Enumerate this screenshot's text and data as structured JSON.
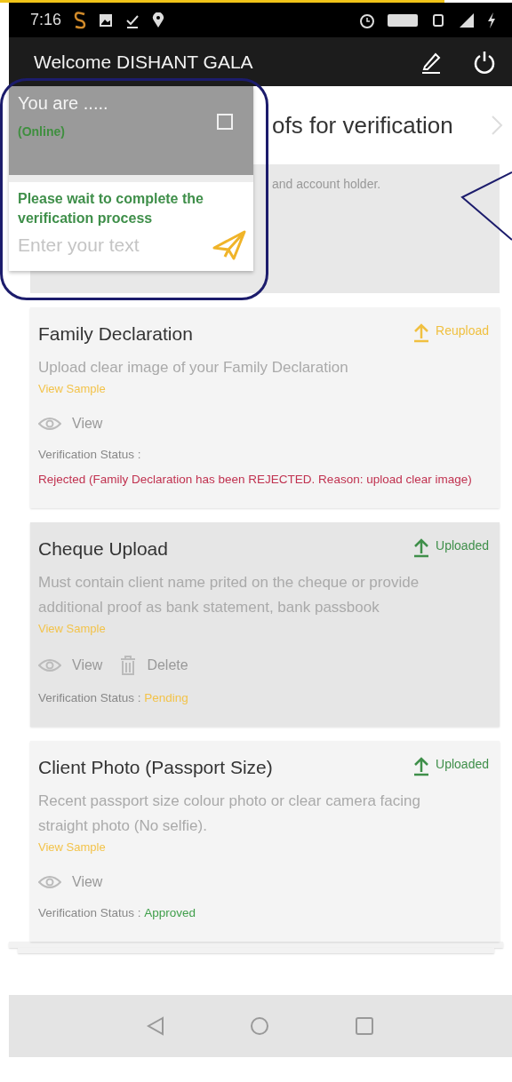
{
  "status_bar": {
    "time": "7:16"
  },
  "app_bar": {
    "title": "Welcome DISHANT GALA"
  },
  "page": {
    "title": "ofs for verification",
    "top_card_text": "and account holder."
  },
  "documents": [
    {
      "title": "Family Declaration",
      "upload": {
        "kind": "reupload",
        "label": "Reupload"
      },
      "description": "Upload clear image of your Family Declaration",
      "sample_link": "View Sample",
      "actions": [
        {
          "kind": "view",
          "label": "View"
        }
      ],
      "status_label": "Verification Status :",
      "status_value": "Rejected (Family Declaration has been REJECTED. Reason: upload clear image)",
      "color": "#c0314f",
      "selected": false
    },
    {
      "title": "Cheque Upload",
      "upload": {
        "kind": "uploaded",
        "label": "Uploaded"
      },
      "description": "Must contain client name prited on the cheque or provide additional proof as bank statement, bank passbook",
      "sample_link": "View Sample",
      "actions": [
        {
          "kind": "view",
          "label": "View"
        },
        {
          "kind": "delete",
          "label": "Delete"
        }
      ],
      "status_label": "Verification Status :",
      "status_value": "Pending",
      "color": "#f3c34a",
      "selected": true
    },
    {
      "title": "Client Photo (Passport Size)",
      "upload": {
        "kind": "uploaded",
        "label": "Uploaded"
      },
      "description": "Recent passport size colour photo or clear camera facing straight photo (No selfie).",
      "sample_link": "View Sample",
      "actions": [
        {
          "kind": "view",
          "label": "View"
        }
      ],
      "status_label": "Verification Status :",
      "status_value": "Approved",
      "color": "#3f9e4a",
      "selected": false
    }
  ],
  "chat": {
    "title": "You are .....",
    "presence": "(Online)",
    "message": "Please wait to complete the verification process",
    "input": {
      "placeholder": "Enter your text"
    }
  }
}
